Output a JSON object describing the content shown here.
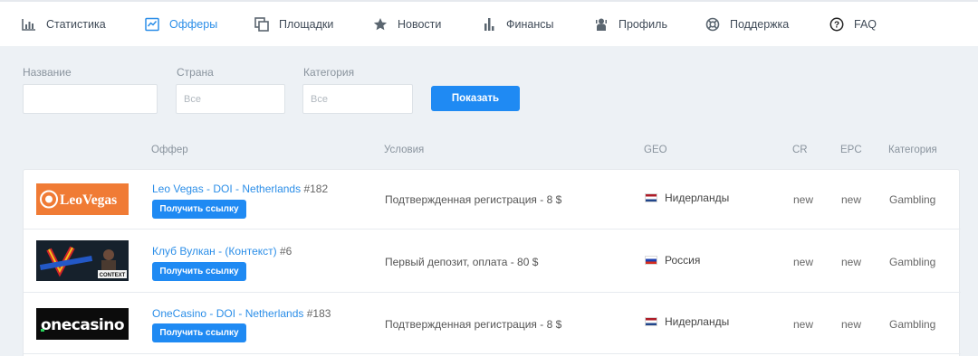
{
  "nav": {
    "items": [
      {
        "label": "Статистика",
        "icon": "bar-chart-icon"
      },
      {
        "label": "Офферы",
        "icon": "line-chart-icon",
        "active": true
      },
      {
        "label": "Площадки",
        "icon": "copy-icon"
      },
      {
        "label": "Новости",
        "icon": "star-icon"
      },
      {
        "label": "Финансы",
        "icon": "bars-icon"
      },
      {
        "label": "Профиль",
        "icon": "user-icon"
      },
      {
        "label": "Поддержка",
        "icon": "life-ring-icon"
      },
      {
        "label": "FAQ",
        "icon": "question-icon"
      }
    ]
  },
  "filters": {
    "name_label": "Название",
    "name_placeholder": "",
    "country_label": "Страна",
    "country_placeholder": "Все",
    "category_label": "Категория",
    "category_placeholder": "Все",
    "show_button": "Показать"
  },
  "table": {
    "headers": {
      "offer": "Оффер",
      "conditions": "Условия",
      "geo": "GEO",
      "cr": "CR",
      "epc": "EPC",
      "category": "Категория"
    },
    "get_link_label": "Получить ссылку",
    "rows": [
      {
        "logo": "LeoVegas",
        "name": "Leo Vegas - DOI - Netherlands",
        "id": "#182",
        "conditions": "Подтвержденная регистрация - 8 $",
        "geo": "Нидерланды",
        "cr": "new",
        "epc": "new",
        "category": "Gambling"
      },
      {
        "logo": "CONTEXT",
        "name": "Клуб Вулкан - (Контекст)",
        "id": "#6",
        "conditions": "Первый депозит, оплата - 80 $",
        "geo": "Россия",
        "cr": "new",
        "epc": "new",
        "category": "Gambling"
      },
      {
        "logo": "onecasino",
        "name": "OneCasino - DOI - Netherlands",
        "id": "#183",
        "conditions": "Подтвержденная регистрация - 8 $",
        "geo": "Нидерланды",
        "cr": "new",
        "epc": "new",
        "category": "Gambling"
      }
    ]
  },
  "colors": {
    "accent": "#1f8af3",
    "link": "#2b8ee8",
    "page_bg": "#edf1f5"
  }
}
